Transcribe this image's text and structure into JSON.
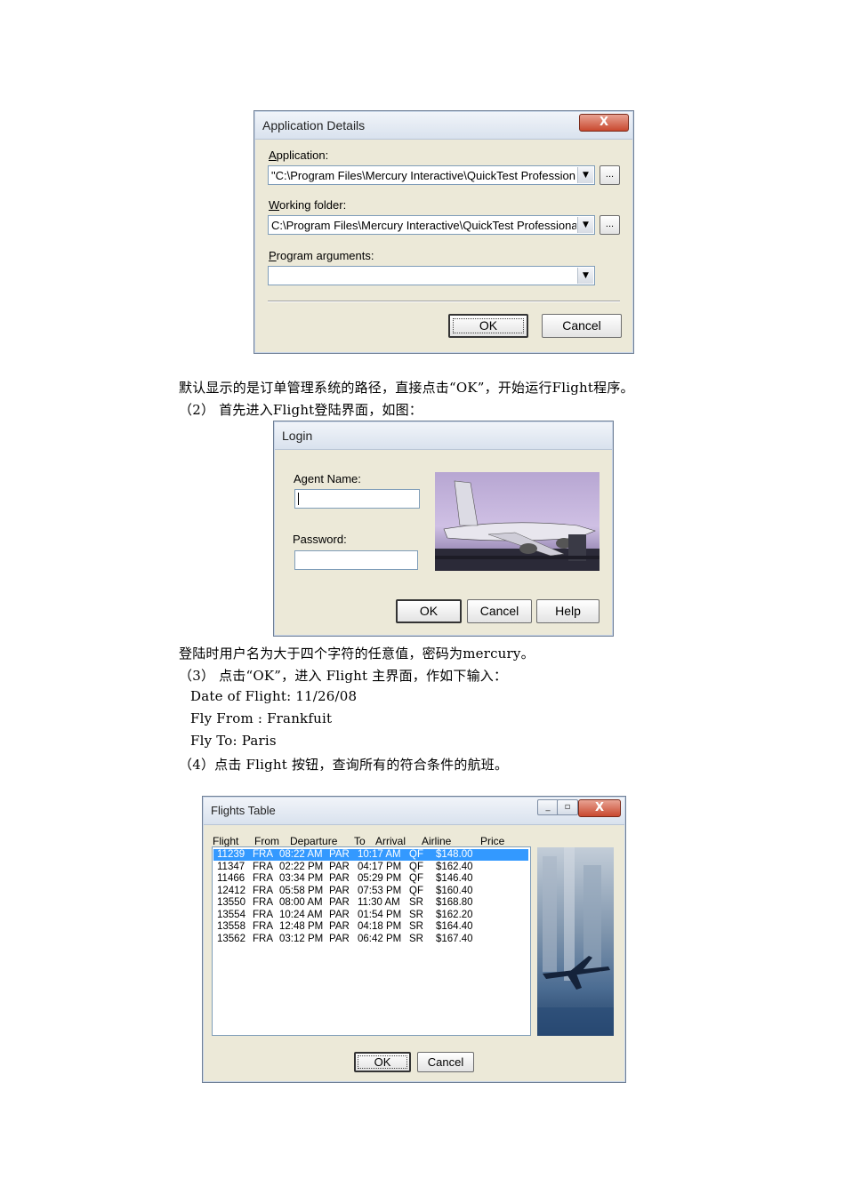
{
  "app_dialog": {
    "title": "Application Details",
    "close_label": "X",
    "application_label_prefix": "A",
    "application_label_rest": "pplication:",
    "application_value": "\"C:\\Program Files\\Mercury Interactive\\QuickTest Profession",
    "working_label_prefix": "W",
    "working_label_rest": "orking folder:",
    "working_value": "C:\\Program Files\\Mercury Interactive\\QuickTest Professiona",
    "args_label_prefix": "P",
    "args_label_rest": "rogram arguments:",
    "args_value": "",
    "browse_label": "...",
    "ok_label": "OK",
    "cancel_label": "Cancel"
  },
  "text": {
    "para1": "默认显示的是订单管理系统的路径，直接点击“OK”，开始运行Flight程序。",
    "para2": "（2）   首先进入Flight登陆界面，如图：",
    "para3": "登陆时用户名为大于四个字符的任意值，密码为mercury。",
    "para4": "（3）   点击“OK”，进入 Flight 主界面，作如下输入：",
    "para5": "Date of  Flight: 11/26/08",
    "para6": "Fly From : Frankfuit",
    "para7": "Fly To: Paris",
    "para8": "（4）点击 Flight 按钮，查询所有的符合条件的航班。"
  },
  "login_dialog": {
    "title": "Login",
    "agent_label": "Agent Name:",
    "agent_value": "",
    "password_label": "Password:",
    "password_value": "",
    "ok_label": "OK",
    "cancel_label": "Cancel",
    "help_label": "Help"
  },
  "flights_dialog": {
    "title": "Flights Table",
    "columns": [
      "Flight",
      "From",
      "Departure",
      "To",
      "Arrival",
      "Airline",
      "Price"
    ],
    "rows": [
      [
        "11239",
        "FRA",
        "08:22 AM",
        "PAR",
        "10:17 AM",
        "QF",
        "$148.00"
      ],
      [
        "11347",
        "FRA",
        "02:22 PM",
        "PAR",
        "04:17 PM",
        "QF",
        "$162.40"
      ],
      [
        "11466",
        "FRA",
        "03:34 PM",
        "PAR",
        "05:29 PM",
        "QF",
        "$146.40"
      ],
      [
        "12412",
        "FRA",
        "05:58 PM",
        "PAR",
        "07:53 PM",
        "QF",
        "$160.40"
      ],
      [
        "13550",
        "FRA",
        "08:00 AM",
        "PAR",
        "11:30 AM",
        "SR",
        "$168.80"
      ],
      [
        "13554",
        "FRA",
        "10:24 AM",
        "PAR",
        "01:54 PM",
        "SR",
        "$162.20"
      ],
      [
        "13558",
        "FRA",
        "12:48 PM",
        "PAR",
        "04:18 PM",
        "SR",
        "$164.40"
      ],
      [
        "13562",
        "FRA",
        "03:12 PM",
        "PAR",
        "06:42 PM",
        "SR",
        "$167.40"
      ]
    ],
    "selected_row": 0,
    "ok_label": "OK",
    "cancel_label": "Cancel",
    "close_label": "X",
    "minimize_label": "_",
    "restore_label": "▫"
  },
  "colors": {
    "selection": "#3399ff",
    "dialog_face": "#ece9d8"
  }
}
